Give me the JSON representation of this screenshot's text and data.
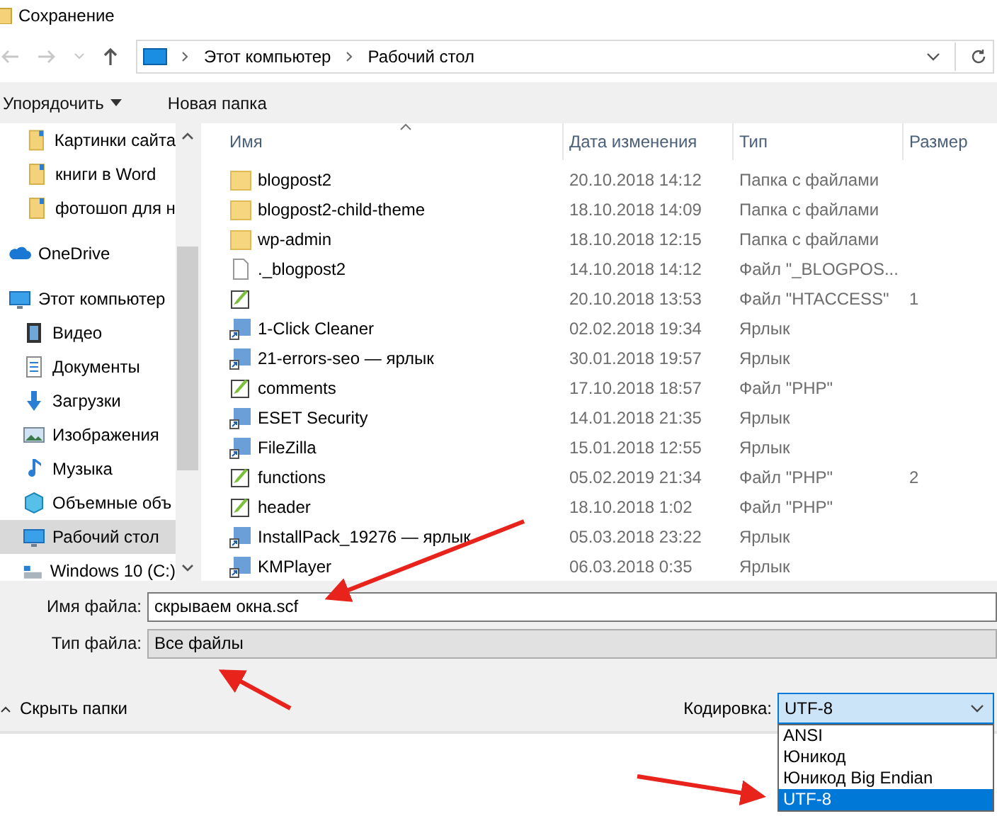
{
  "window": {
    "title": "Сохранение"
  },
  "nav": {
    "path": [
      "Этот компьютер",
      "Рабочий стол"
    ]
  },
  "toolbar": {
    "organize": "Упорядочить",
    "new_folder": "Новая папка"
  },
  "sidebar": {
    "items": [
      {
        "label": "Картинки сайта",
        "kind": "pinned",
        "selected": false
      },
      {
        "label": "книги в Word",
        "kind": "pinned",
        "selected": false
      },
      {
        "label": "фотошоп для н",
        "kind": "pinned",
        "selected": false
      },
      {
        "label": "OneDrive",
        "kind": "cloud",
        "selected": false
      },
      {
        "label": "Этот компьютер",
        "kind": "computer",
        "selected": false
      },
      {
        "label": "Видео",
        "kind": "video",
        "selected": false
      },
      {
        "label": "Документы",
        "kind": "docs",
        "selected": false
      },
      {
        "label": "Загрузки",
        "kind": "download",
        "selected": false
      },
      {
        "label": "Изображения",
        "kind": "pictures",
        "selected": false
      },
      {
        "label": "Музыка",
        "kind": "music",
        "selected": false
      },
      {
        "label": "Объемные объ",
        "kind": "cube",
        "selected": false
      },
      {
        "label": "Рабочий стол",
        "kind": "desktop",
        "selected": true
      },
      {
        "label": "Windows 10 (C:)",
        "kind": "drive",
        "selected": false
      }
    ]
  },
  "table": {
    "columns": [
      "Имя",
      "Дата изменения",
      "Тип",
      "Размер"
    ],
    "rows": [
      {
        "name": "blogpost2",
        "kind": "folder",
        "date": "20.10.2018 14:12",
        "type": "Папка с файлами"
      },
      {
        "name": "blogpost2-child-theme",
        "kind": "folder",
        "date": "18.10.2018 14:09",
        "type": "Папка с файлами"
      },
      {
        "name": "wp-admin",
        "kind": "folder",
        "date": "18.10.2018 12:15",
        "type": "Папка с файлами"
      },
      {
        "name": "._blogpost2",
        "kind": "file",
        "date": "14.10.2018 14:12",
        "type": "Файл \"_BLOGPOS..."
      },
      {
        "name": "",
        "kind": "text",
        "date": "20.10.2018 13:53",
        "type": "Файл \"HTACCESS\"",
        "size": "1"
      },
      {
        "name": "1-Click Cleaner",
        "kind": "shortcut",
        "date": "02.02.2018 19:34",
        "type": "Ярлык"
      },
      {
        "name": "21-errors-seo — ярлык",
        "kind": "shortcut",
        "date": "30.01.2018 19:57",
        "type": "Ярлык"
      },
      {
        "name": "comments",
        "kind": "text",
        "date": "17.10.2018 18:57",
        "type": "Файл \"PHP\""
      },
      {
        "name": "ESET Security",
        "kind": "shortcut",
        "date": "14.01.2018 21:35",
        "type": "Ярлык"
      },
      {
        "name": "FileZilla",
        "kind": "shortcut",
        "date": "15.01.2018 12:55",
        "type": "Ярлык"
      },
      {
        "name": "functions",
        "kind": "text",
        "date": "05.02.2019 21:34",
        "type": "Файл \"PHP\"",
        "size": "2"
      },
      {
        "name": "header",
        "kind": "text",
        "date": "18.10.2018 1:02",
        "type": "Файл \"PHP\""
      },
      {
        "name": "InstallPack_19276 — ярлык",
        "kind": "shortcut",
        "date": "05.03.2018 23:22",
        "type": "Ярлык"
      },
      {
        "name": "KMPlayer",
        "kind": "shortcut",
        "date": "06.03.2018 0:35",
        "type": "Ярлык"
      }
    ]
  },
  "form": {
    "filename_label": "Имя файла:",
    "filename_value": "скрываем окна.scf",
    "filetype_label": "Тип файла:",
    "filetype_value": "Все файлы"
  },
  "hide_folders": "Скрыть папки",
  "encoding": {
    "label": "Кодировка:",
    "value": "UTF-8",
    "expanded": true,
    "options": [
      {
        "label": "ANSI",
        "selected": false
      },
      {
        "label": "Юникод",
        "selected": false
      },
      {
        "label": "Юникод Big Endian",
        "selected": false
      },
      {
        "label": "UTF-8",
        "selected": true
      }
    ]
  }
}
